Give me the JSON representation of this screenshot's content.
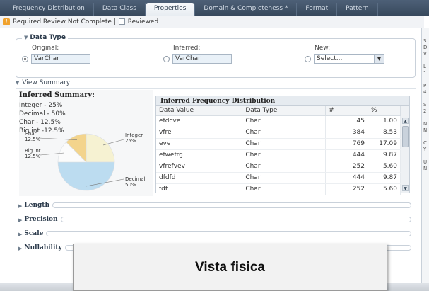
{
  "tabs": [
    {
      "label": "Frequency Distribution",
      "active": false
    },
    {
      "label": "Data Class",
      "active": false
    },
    {
      "label": "Properties",
      "active": true
    },
    {
      "label": "Domain & Completeness *",
      "active": false
    },
    {
      "label": "Format",
      "active": false
    },
    {
      "label": "Pattern",
      "active": false
    }
  ],
  "review": {
    "status_text": "Required Review Not Complete |",
    "reviewed_label": "Reviewed"
  },
  "data_type": {
    "legend": "Data Type",
    "original_label": "Original:",
    "original_value": "VarChar",
    "inferred_label": "Inferred:",
    "inferred_value": "VarChar",
    "new_label": "New:",
    "new_value": "Select..."
  },
  "view_summary": {
    "label": "View Summary"
  },
  "inferred_summary": {
    "title": "Inferred Summary:",
    "lines": [
      "Integer - 25%",
      "Decimal - 50%",
      "Char - 12.5%",
      "Big int -12.5%"
    ]
  },
  "chart_data": {
    "type": "pie",
    "title": "",
    "slices": [
      {
        "label": "Integer",
        "value": 25,
        "display": "25%",
        "color": "#f6f2d2"
      },
      {
        "label": "Decimal",
        "value": 50,
        "display": "50%",
        "color": "#bcdcf0"
      },
      {
        "label": "Big int",
        "value": 12.5,
        "display": "12.5%",
        "color": "#fbfbfb"
      },
      {
        "label": "Char",
        "value": 12.5,
        "display": "12.5%",
        "color": "#f3d48c"
      }
    ]
  },
  "frequency": {
    "title": "Inferred Frequency Distribution",
    "columns": [
      "Data Value",
      "Data Type",
      "#",
      "%"
    ],
    "rows": [
      [
        "efdcve",
        "Char",
        "45",
        "1.00"
      ],
      [
        "vfre",
        "Char",
        "384",
        "8.53"
      ],
      [
        "eve",
        "Char",
        "769",
        "17.09"
      ],
      [
        "efwefrg",
        "Char",
        "444",
        "9.87"
      ],
      [
        "vfrefvev",
        "Char",
        "252",
        "5.60"
      ],
      [
        "dfdfd",
        "Char",
        "444",
        "9.87"
      ],
      [
        "fdf",
        "Char",
        "252",
        "5.60"
      ]
    ]
  },
  "sections": [
    "Length",
    "Precision",
    "Scale",
    "Nullability"
  ],
  "right_panel": {
    "lines": [
      "S",
      "D",
      "V",
      "",
      "L",
      "1",
      "",
      "P",
      "4",
      "",
      "S",
      "2",
      "",
      "N",
      "N",
      "",
      "C",
      "Y",
      "",
      "U",
      "N"
    ]
  },
  "caption": "Vista fisica",
  "colors": {
    "tabbar": "#3f5067",
    "accent": "#f0a22e",
    "pie_decimal": "#bcdcf0",
    "pie_integer": "#f6f2d2",
    "pie_char": "#f3d48c"
  }
}
